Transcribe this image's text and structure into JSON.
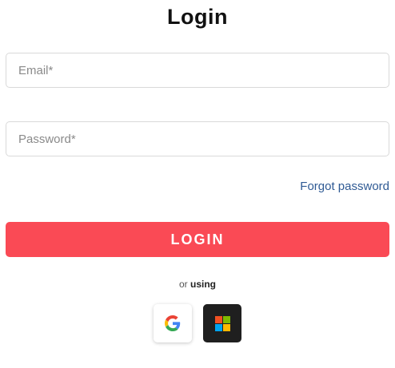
{
  "title": "Login",
  "form": {
    "email_placeholder": "Email*",
    "password_placeholder": "Password*",
    "forgot_password": "Forgot password",
    "login_label": "LOGIN"
  },
  "alt_login": {
    "prefix": "or",
    "emphasis": "using",
    "providers": [
      {
        "name": "Google",
        "icon": "google-icon"
      },
      {
        "name": "Microsoft",
        "icon": "microsoft-icon"
      }
    ]
  },
  "colors": {
    "accent": "#fa4a55",
    "link": "#2f5a94",
    "microsoft_bg": "#1f1f1f",
    "ms_red": "#f25022",
    "ms_green": "#7fba00",
    "ms_blue": "#00a4ef",
    "ms_yellow": "#ffb900"
  }
}
